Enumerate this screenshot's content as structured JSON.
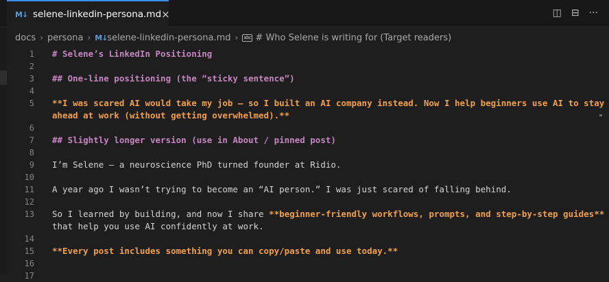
{
  "tab": {
    "icon": "markdown-icon",
    "icon_text": "M↓",
    "title": "selene-linkedin-persona.md",
    "close": "×"
  },
  "top_actions": [
    {
      "name": "open-preview-to-side-icon",
      "glyph": "◫"
    },
    {
      "name": "split-editor-icon",
      "glyph": "⊟"
    },
    {
      "name": "more-actions-icon",
      "glyph": "···"
    }
  ],
  "breadcrumb": {
    "items": [
      "docs",
      "persona",
      "selene-linkedin-persona.md",
      "# Who Selene is writing for (Target readers)"
    ],
    "separator": "›",
    "symbol_icon_text": "abc"
  },
  "colors": {
    "heading": "#c586c0",
    "bold": "#f0a04a",
    "text": "#d4d4d4",
    "line_number": "#858585",
    "accent": "#3b8eea"
  },
  "editor": {
    "line_numbers": [
      "1",
      "2",
      "3",
      "4",
      "5",
      "6",
      "7",
      "8",
      "9",
      "10",
      "11",
      "12",
      "13",
      "14",
      "15",
      "16",
      "17"
    ],
    "lines": {
      "l1": "# Selene’s LinkedIn Positioning",
      "l3": "## One-line positioning (the “sticky sentence”)",
      "l5a": "**I was scared AI would take my job — so I built an AI company instead. Now I help beginners use AI to stay",
      "l5b": "ahead at work (without getting overwhelmed).**",
      "l7": "## Slightly longer version (use in About / pinned post)",
      "l9": "I’m Selene — a neuroscience PhD turned founder at Ridio.",
      "l11": "A year ago I wasn’t trying to become an “AI person.” I was just scared of falling behind.",
      "l13_plain": "So I learned by building, and now I share ",
      "l13_bold": "**beginner-friendly workflows, prompts, and step-by-step guides**",
      "l13b": "that help you use AI confidently at work.",
      "l15": "**Every post includes something you can copy/paste and use today.**"
    }
  }
}
